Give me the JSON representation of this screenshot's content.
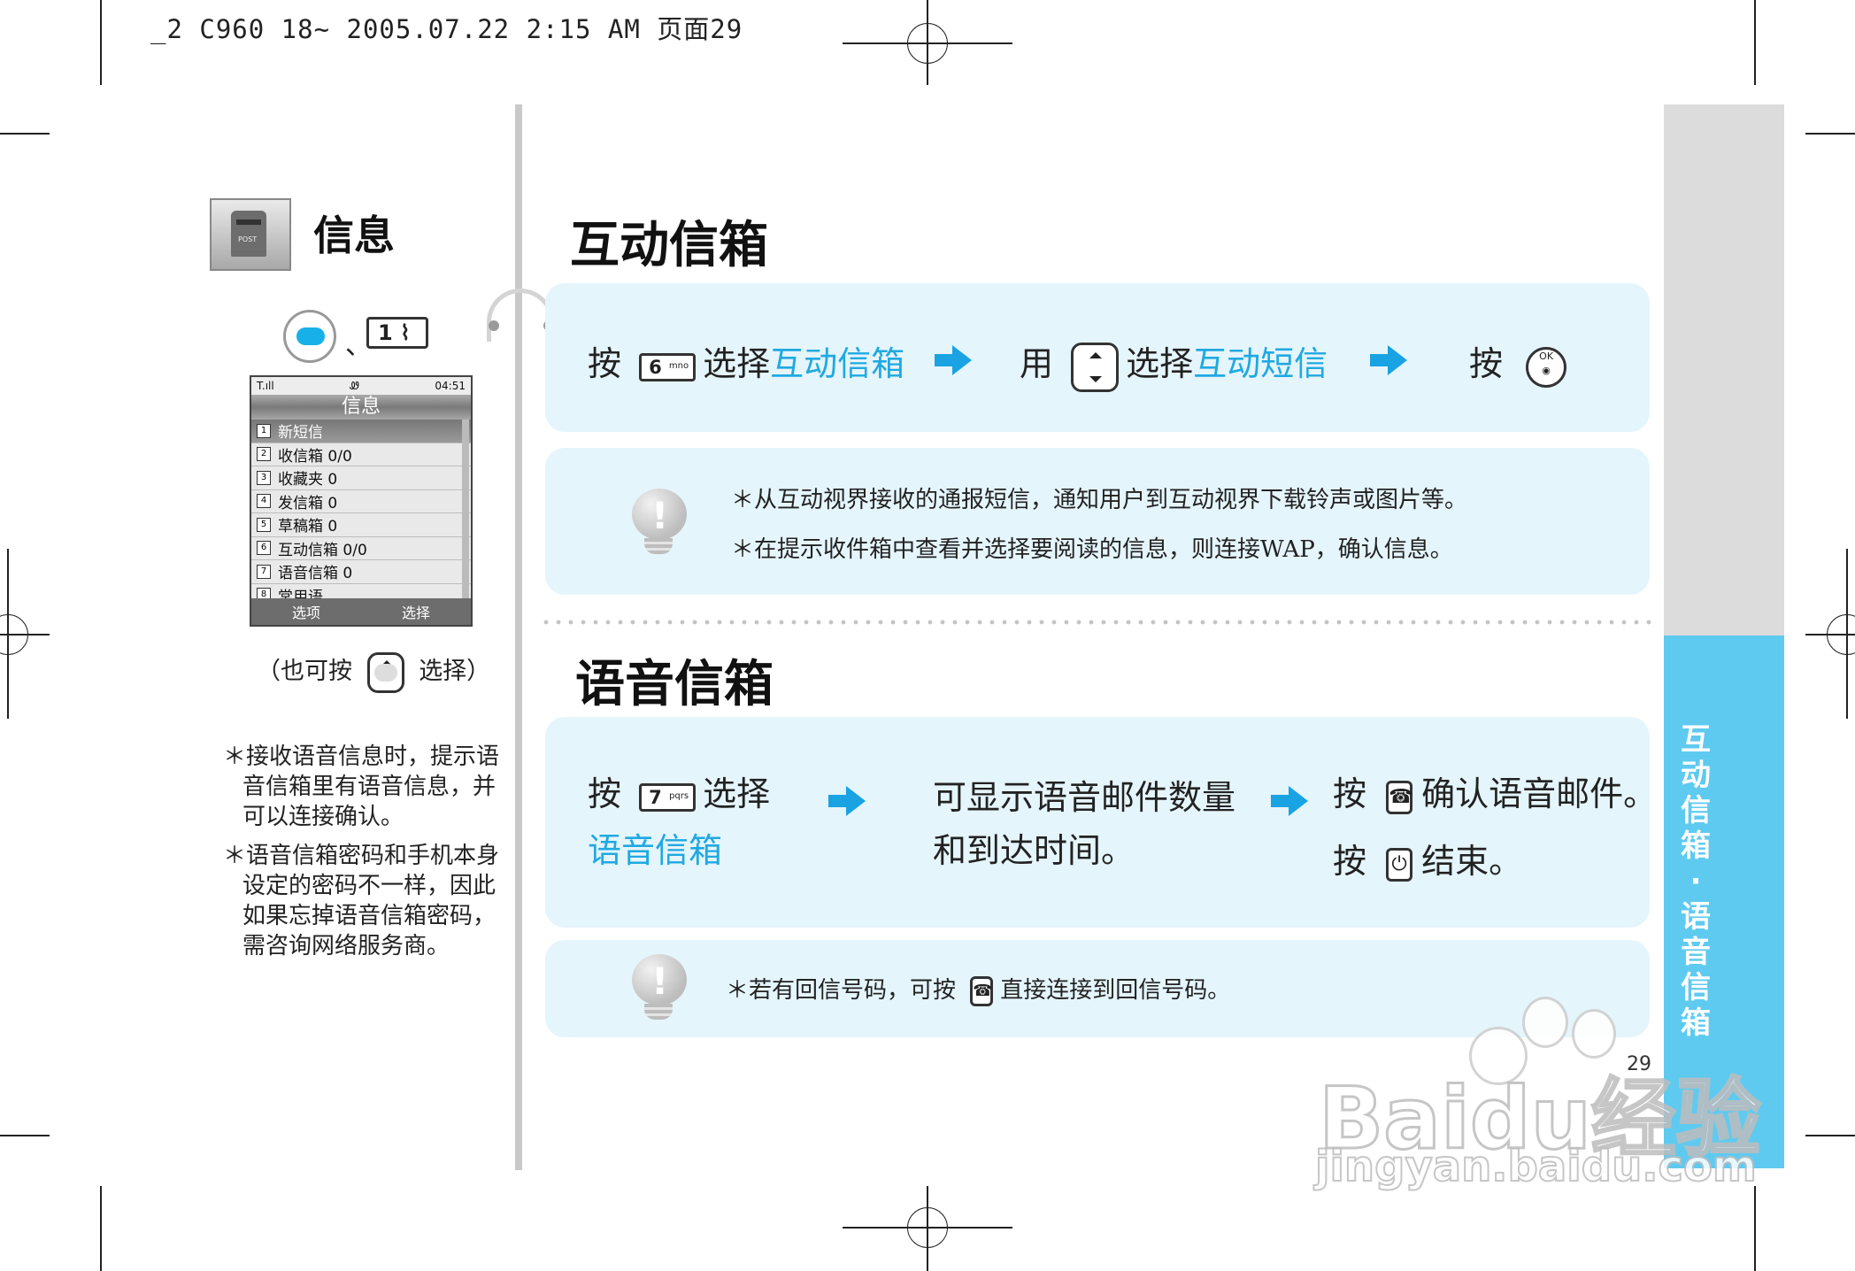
{
  "header": {
    "print_info": "_2  C960  18~  2005.07.22  2:15  AM  页面29"
  },
  "sidebar_left": {
    "title": "信息",
    "key_separator": "、",
    "key_1_label": "1",
    "phone_screen": {
      "status_left": "T.ıll",
      "status_mid": "Ꮺ",
      "status_right": "04:51",
      "title": "信息",
      "items": [
        {
          "num": "1",
          "label": "新短信",
          "selected": true
        },
        {
          "num": "2",
          "label": "收信箱  0/0"
        },
        {
          "num": "3",
          "label": "收藏夹  0"
        },
        {
          "num": "4",
          "label": "发信箱  0"
        },
        {
          "num": "5",
          "label": "草稿箱  0"
        },
        {
          "num": "6",
          "label": "互动信箱  0/0"
        },
        {
          "num": "7",
          "label": "语音信箱  0"
        },
        {
          "num": "8",
          "label": "常用语"
        }
      ],
      "soft_left": "选项",
      "soft_right": "选择"
    },
    "also_prefix": "（也可按",
    "also_suffix": "选择）",
    "notes": [
      "＊接收语音信息时，提示语音信箱里有语音信息，并可以连接确认。",
      "＊语音信箱密码和手机本身设定的密码不一样，因此如果忘掉语音信箱密码，需咨询网络服务商。"
    ]
  },
  "section1": {
    "title": "互动信箱",
    "step1_press": "按",
    "step1_key": "6",
    "step1_key_sub": "mno",
    "step1_select": "选择",
    "step1_target": "互动信箱",
    "step2_use": "用",
    "step2_select": "选择",
    "step2_target": "互动短信",
    "step3_press": "按",
    "ok_key": "OK",
    "tips": [
      "＊从互动视界接收的通报短信，通知用户到互动视界下载铃声或图片等。",
      "＊在提示收件箱中查看并选择要阅读的信息，则连接WAP，确认信息。"
    ]
  },
  "section2": {
    "title": "语音信箱",
    "step1_press": "按",
    "step1_key": "7",
    "step1_key_sub": "pqrs",
    "step1_select": "选择",
    "step1_target": "语音信箱",
    "step2_line1": "可显示语音邮件数量",
    "step2_line2": "和到达时间。",
    "step3a_press": "按",
    "step3a_text": "确认语音邮件。",
    "step3b_press": "按",
    "step3b_text": "结束。",
    "tip_prefix": "＊若有回信号码，可按",
    "tip_suffix": "直接连接到回信号码。"
  },
  "side_tab": {
    "chars": [
      "互",
      "动",
      "信",
      "箱",
      "·",
      "语",
      "音",
      "信",
      "箱"
    ]
  },
  "page_number": "29",
  "watermark": {
    "line1": "Baidu经验",
    "line2": "jingyan.baidu.com"
  },
  "colors": {
    "accent": "#20a9e1",
    "panel": "#e5f5fc",
    "tab": "#5fcaf0",
    "tab_gray": "#dcdcdc"
  }
}
